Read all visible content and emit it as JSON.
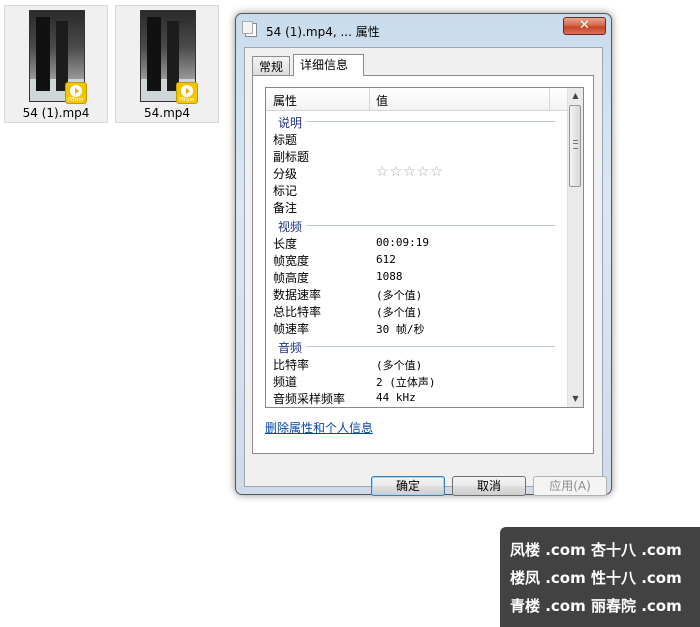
{
  "desktop": {
    "files": [
      {
        "name": "54 (1).mp4",
        "badge_text": "PBlyer"
      },
      {
        "name": "54.mp4",
        "badge_text": "PBlyer"
      }
    ]
  },
  "dialog": {
    "title": "54 (1).mp4, ... 属性",
    "close_label": "✕",
    "tabs": [
      {
        "label": "常规",
        "active": false
      },
      {
        "label": "详细信息",
        "active": true
      }
    ],
    "list": {
      "headers": {
        "property": "属性",
        "value": "值"
      },
      "sections": {
        "description": {
          "title": "说明",
          "rows": [
            {
              "key": "标题",
              "value": ""
            },
            {
              "key": "副标题",
              "value": ""
            },
            {
              "key": "分级",
              "value": "☆☆☆☆☆"
            },
            {
              "key": "标记",
              "value": ""
            },
            {
              "key": "备注",
              "value": ""
            }
          ]
        },
        "video": {
          "title": "视频",
          "rows": [
            {
              "key": "长度",
              "value": "00:09:19"
            },
            {
              "key": "帧宽度",
              "value": "612"
            },
            {
              "key": "帧高度",
              "value": "1088"
            },
            {
              "key": "数据速率",
              "value": "(多个值)"
            },
            {
              "key": "总比特率",
              "value": "(多个值)"
            },
            {
              "key": "帧速率",
              "value": "30 帧/秒"
            }
          ]
        },
        "audio": {
          "title": "音频",
          "rows": [
            {
              "key": "比特率",
              "value": "(多个值)"
            },
            {
              "key": "频道",
              "value": "2 (立体声)"
            },
            {
              "key": "音频采样频率",
              "value": "44 kHz"
            }
          ]
        }
      }
    },
    "remove_link": "删除属性和个人信息",
    "buttons": {
      "ok": "确定",
      "cancel": "取消",
      "apply": "应用(A)"
    }
  },
  "watermark": {
    "lines": [
      "凤楼 .com  杏十八 .com",
      "楼凤 .com  性十八 .com",
      "青楼 .com  丽春院 .com"
    ]
  }
}
